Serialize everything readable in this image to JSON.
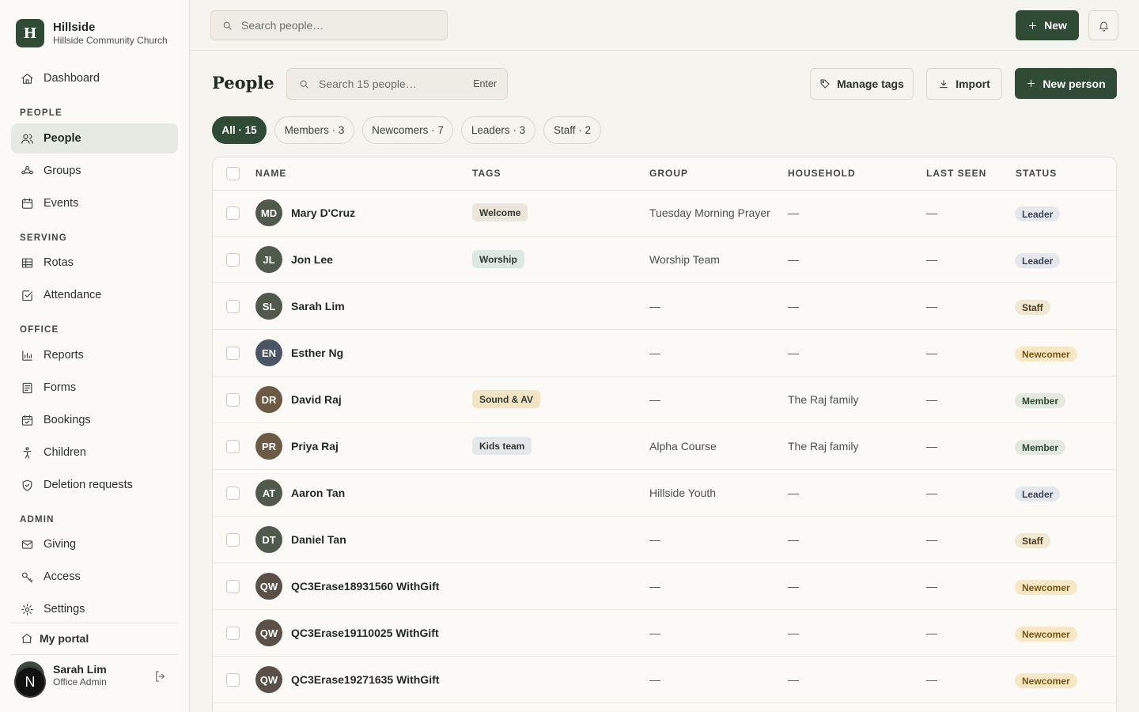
{
  "brand": {
    "logo_letter": "H",
    "name": "Hillside",
    "subtitle": "Hillside Community Church"
  },
  "sidebar": {
    "dashboard": "Dashboard",
    "sections": {
      "people": "PEOPLE",
      "serving": "SERVING",
      "office": "OFFICE",
      "admin": "ADMIN"
    },
    "items": {
      "people": "People",
      "groups": "Groups",
      "events": "Events",
      "rotas": "Rotas",
      "attendance": "Attendance",
      "reports": "Reports",
      "forms": "Forms",
      "bookings": "Bookings",
      "children": "Children",
      "deletion": "Deletion requests",
      "giving": "Giving",
      "access": "Access",
      "settings": "Settings"
    },
    "portal": "My portal",
    "user": {
      "name": "Sarah Lim",
      "role": "Office Admin",
      "badge": "N"
    }
  },
  "topbar": {
    "search_placeholder": "Search people…",
    "new_label": "New"
  },
  "page": {
    "title": "People",
    "search_placeholder": "Search 15 people…",
    "search_hint": "Enter",
    "manage_tags": "Manage tags",
    "import": "Import",
    "new_person": "New person"
  },
  "filters": [
    "All · 15",
    "Members · 3",
    "Newcomers · 7",
    "Leaders · 3",
    "Staff · 2"
  ],
  "table": {
    "headers": {
      "name": "NAME",
      "tags": "TAGS",
      "group": "GROUP",
      "household": "HOUSEHOLD",
      "last_seen": "LAST SEEN",
      "status": "STATUS"
    },
    "rows": [
      {
        "initials": "MD",
        "name": "Mary D'Cruz",
        "tag": "Welcome",
        "group": "Tuesday Morning Prayer",
        "household": "—",
        "last_seen": "—",
        "status": "Leader"
      },
      {
        "initials": "JL",
        "name": "Jon Lee",
        "tag": "Worship",
        "group": "Worship Team",
        "household": "—",
        "last_seen": "—",
        "status": "Leader"
      },
      {
        "initials": "SL",
        "name": "Sarah Lim",
        "tag": "",
        "group": "—",
        "household": "—",
        "last_seen": "—",
        "status": "Staff"
      },
      {
        "initials": "EN",
        "name": "Esther Ng",
        "tag": "",
        "group": "—",
        "household": "—",
        "last_seen": "—",
        "status": "Newcomer"
      },
      {
        "initials": "DR",
        "name": "David Raj",
        "tag": "Sound & AV",
        "group": "—",
        "household": "The Raj family",
        "last_seen": "—",
        "status": "Member"
      },
      {
        "initials": "PR",
        "name": "Priya Raj",
        "tag": "Kids team",
        "group": "Alpha Course",
        "household": "The Raj family",
        "last_seen": "—",
        "status": "Member"
      },
      {
        "initials": "AT",
        "name": "Aaron Tan",
        "tag": "",
        "group": "Hillside Youth",
        "household": "—",
        "last_seen": "—",
        "status": "Leader"
      },
      {
        "initials": "DT",
        "name": "Daniel Tan",
        "tag": "",
        "group": "—",
        "household": "—",
        "last_seen": "—",
        "status": "Staff"
      },
      {
        "initials": "QW",
        "name": "QC3Erase18931560 WithGift",
        "tag": "",
        "group": "—",
        "household": "—",
        "last_seen": "—",
        "status": "Newcomer"
      },
      {
        "initials": "QW",
        "name": "QC3Erase19110025 WithGift",
        "tag": "",
        "group": "—",
        "household": "—",
        "last_seen": "—",
        "status": "Newcomer"
      },
      {
        "initials": "QW",
        "name": "QC3Erase19271635 WithGift",
        "tag": "",
        "group": "—",
        "household": "—",
        "last_seen": "—",
        "status": "Newcomer"
      }
    ]
  },
  "colors": {
    "brand": "#2f4a35",
    "status": {
      "Leader": "#e4e7ec",
      "Staff": "#f1e8d2",
      "Newcomer": "#f7e7c4",
      "Member": "#e3e9df"
    },
    "tags": {
      "Welcome": "#ece6da",
      "Worship": "#dde7e3",
      "Sound & AV": "#f3e4c6",
      "Kids team": "#e4e8ea"
    },
    "avatars": {
      "MD": "#4f5a4d",
      "JL": "#4f5a4d",
      "SL": "#4f5a4d",
      "EN": "#4a5566",
      "DR": "#6d5a44",
      "PR": "#6d5a44",
      "AT": "#4f5a4d",
      "DT": "#4f5a4d",
      "QW": "#5a5048"
    }
  }
}
